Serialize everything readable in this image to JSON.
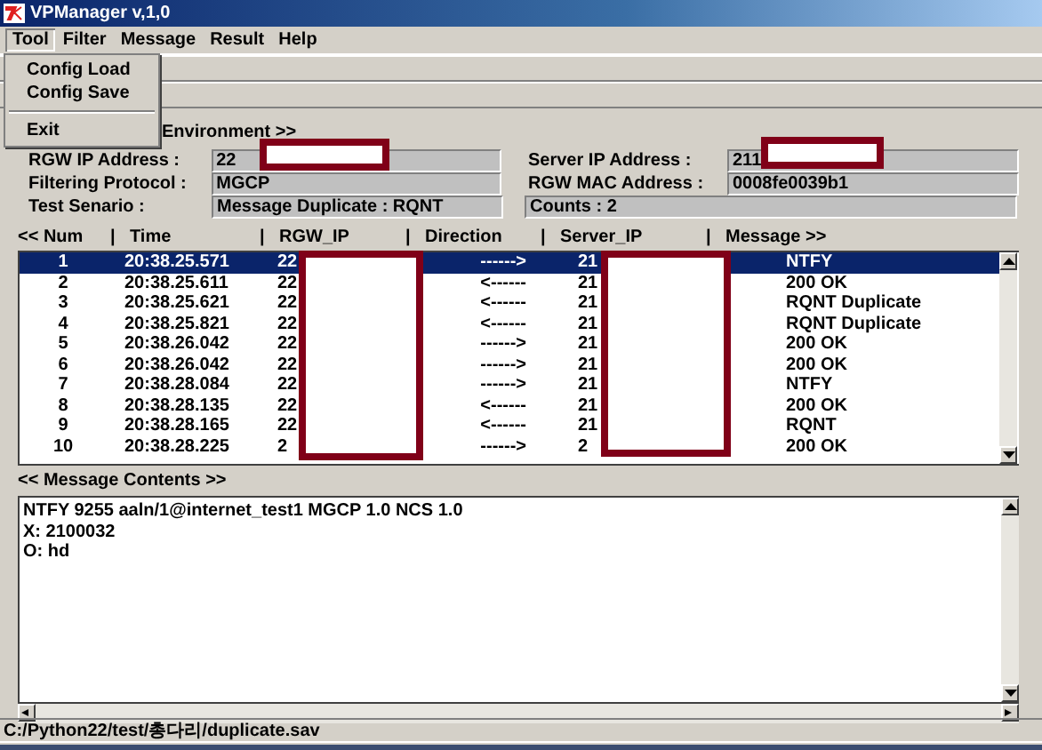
{
  "window": {
    "title": "VPManager v,1,0"
  },
  "menu": [
    {
      "label": "Tool",
      "open": true
    },
    {
      "label": "Filter",
      "open": false
    },
    {
      "label": "Message",
      "open": false
    },
    {
      "label": "Result",
      "open": false
    },
    {
      "label": "Help",
      "open": false
    }
  ],
  "dropdown": [
    {
      "kind": "item",
      "label": "Config Load"
    },
    {
      "kind": "item",
      "label": "Config Save"
    },
    {
      "kind": "separator"
    },
    {
      "kind": "item",
      "label": "Exit"
    }
  ],
  "settings": {
    "heading": "Environment >>",
    "left": [
      {
        "label": "RGW IP Address :",
        "value": "22",
        "redacted": true
      },
      {
        "label": "Filtering Protocol :",
        "value": "MGCP"
      },
      {
        "label": "Test Senario :",
        "value": "Message Duplicate : RQNT"
      }
    ],
    "right": [
      {
        "kind": "labeled",
        "label": "Server IP Address :",
        "value": "211",
        "redacted": true
      },
      {
        "kind": "labeled",
        "label": "RGW  MAC Address :",
        "value": "0008fe0039b1"
      },
      {
        "kind": "plain",
        "value": "Counts  :  2"
      }
    ]
  },
  "packets": {
    "columns": [
      {
        "label": "<< Num",
        "separator": "|"
      },
      {
        "label": "Time",
        "separator": "|"
      },
      {
        "label": "RGW_IP",
        "separator": "|",
        "redacted": true
      },
      {
        "label": "Direction",
        "separator": "|"
      },
      {
        "label": "Server_IP",
        "separator": "|",
        "redacted": true
      },
      {
        "label": "Message >>"
      }
    ],
    "rows": [
      {
        "cells": [
          "1",
          "20:38.25.571",
          "22",
          "------>",
          "21",
          "NTFY"
        ],
        "selected": true
      },
      {
        "cells": [
          "2",
          "20:38.25.611",
          "22",
          "<------",
          "21",
          "200 OK"
        ],
        "selected": false
      },
      {
        "cells": [
          "3",
          "20:38.25.621",
          "22",
          "<------",
          "21",
          "RQNT Duplicate"
        ],
        "selected": false
      },
      {
        "cells": [
          "4",
          "20:38.25.821",
          "22",
          "<------",
          "21",
          "RQNT Duplicate"
        ],
        "selected": false
      },
      {
        "cells": [
          "5",
          "20:38.26.042",
          "22",
          "------>",
          "21",
          "200 OK"
        ],
        "selected": false
      },
      {
        "cells": [
          "6",
          "20:38.26.042",
          "22",
          "------>",
          "21",
          "200 OK"
        ],
        "selected": false
      },
      {
        "cells": [
          "7",
          "20:38.28.084",
          "22",
          "------>",
          "21",
          "NTFY"
        ],
        "selected": false
      },
      {
        "cells": [
          "8",
          "20:38.28.135",
          "22",
          "<------",
          "21",
          "200 OK"
        ],
        "selected": false
      },
      {
        "cells": [
          "9",
          "20:38.28.165",
          "22",
          "<------",
          "21",
          "RQNT"
        ],
        "selected": false
      },
      {
        "cells": [
          "10",
          "20:38.28.225",
          "2",
          "------>",
          "2",
          "200 OK"
        ],
        "selected": false
      }
    ]
  },
  "contents": {
    "heading": "<< Message Contents >>",
    "lines": [
      "NTFY 9255 aaln/1@internet_test1 MGCP 1.0 NCS 1.0",
      "X: 2100032",
      "O: hd"
    ]
  },
  "status_bar": "C:/Python22/test/총다리/duplicate.sav"
}
